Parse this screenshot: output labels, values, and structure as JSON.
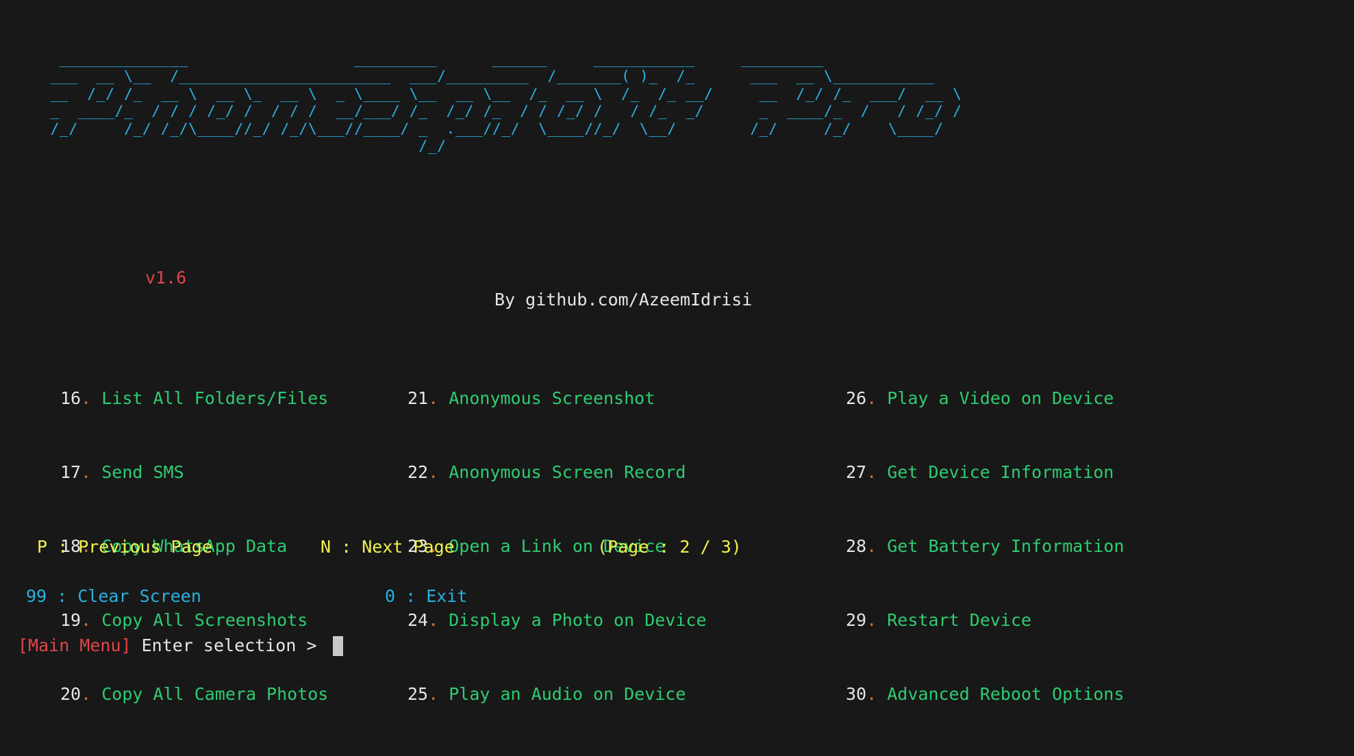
{
  "terminal": {
    "background_color": "#181818",
    "banner_color": "#2ab0e0",
    "accent_green": "#2ecc71",
    "accent_yellow": "#f2f24e",
    "accent_cyan": "#2ab0e0",
    "accent_red": "#e0464a",
    "banner_ascii": "  ______________                  _________      ______     ___________     _________\n ___  __ \\__  /_______________________  ___/_________  /_______( )_  /_      ___  __ \\___________\n __  /_/ /_  __ \\  __ \\_  __ \\  _ \\____ \\__  __ \\__  /_  __ \\  /_  /_ __/     __  /_/ /_  ___/  __ \\\n _  ____/_  / / / /_/ /  / / /  __/___/ /_  /_/ /_  / / /_/ /   / /_  _/      _  ____/_  /   / /_/ /\n /_/     /_/ /_/\\____//_/ /_/\\___//____/ _  .___//_/  \\____//_/  \\__/        /_/     /_/    \\____/\n                                         /_/"
  },
  "meta": {
    "version": "v1.6",
    "author": "By github.com/AzeemIdrisi"
  },
  "menu": {
    "columns": [
      {
        "items": [
          {
            "num": "16",
            "dot": ".",
            "label": "List All Folders/Files"
          },
          {
            "num": "17",
            "dot": ".",
            "label": "Send SMS"
          },
          {
            "num": "18",
            "dot": ".",
            "label": "Copy WhatsApp Data"
          },
          {
            "num": "19",
            "dot": ".",
            "label": "Copy All Screenshots"
          },
          {
            "num": "20",
            "dot": ".",
            "label": "Copy All Camera Photos"
          }
        ]
      },
      {
        "items": [
          {
            "num": "21",
            "dot": ".",
            "label": "Anonymous Screenshot"
          },
          {
            "num": "22",
            "dot": ".",
            "label": "Anonymous Screen Record"
          },
          {
            "num": "23",
            "dot": ".",
            "label": "Open a Link on Device"
          },
          {
            "num": "24",
            "dot": ".",
            "label": "Display a Photo on Device"
          },
          {
            "num": "25",
            "dot": ".",
            "label": "Play an Audio on Device"
          }
        ]
      },
      {
        "items": [
          {
            "num": "26",
            "dot": ".",
            "label": "Play a Video on Device"
          },
          {
            "num": "27",
            "dot": ".",
            "label": "Get Device Information"
          },
          {
            "num": "28",
            "dot": ".",
            "label": "Get Battery Information"
          },
          {
            "num": "29",
            "dot": ".",
            "label": "Restart Device"
          },
          {
            "num": "30",
            "dot": ".",
            "label": "Advanced Reboot Options"
          }
        ]
      }
    ]
  },
  "pager": {
    "previous": "P : Previous Page",
    "next": "N : Next Page",
    "count": "(Page : 2 / 3)",
    "current_page": 2,
    "total_pages": 3
  },
  "utility": {
    "clear_screen": "99 : Clear Screen",
    "exit": "0 : Exit"
  },
  "prompt": {
    "tag": "[Main Menu]",
    "text": " Enter selection > ",
    "value": ""
  }
}
